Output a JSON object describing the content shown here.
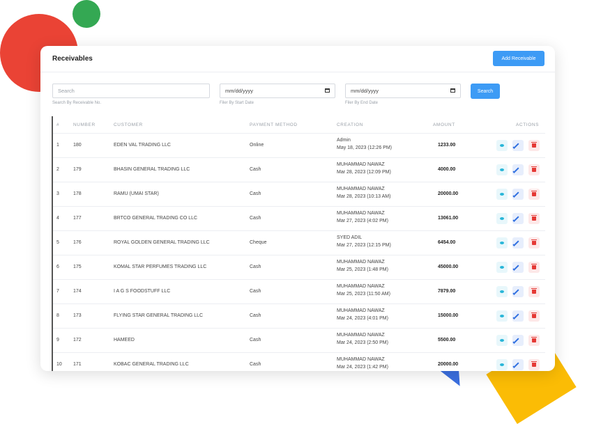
{
  "page": {
    "title": "Receivables",
    "add_button": "Add Receivable"
  },
  "filters": {
    "search_placeholder": "Search",
    "search_hint": "Search By Receivable No.",
    "start_date": "mm/dd/yyyy",
    "start_hint": "Filer By Start Date",
    "end_date": "mm/dd/yyyy",
    "end_hint": "Filer By End Date",
    "search_button": "Search"
  },
  "table": {
    "headers": {
      "index": "#",
      "number": "NUMBER",
      "customer": "CUSTOMER",
      "payment": "PAYMENT METHOD",
      "creation": "CREATION",
      "amount": "AMOUNT",
      "actions": "ACTIONS"
    },
    "rows": [
      {
        "index": "1",
        "number": "180",
        "customer": "EDEN VAL TRADING LLC",
        "payment": "Online",
        "created_by": "Admin",
        "created_at": "May 18, 2023 (12:26 PM)",
        "amount": "1233.00"
      },
      {
        "index": "2",
        "number": "179",
        "customer": "BHASIN GENERAL TRADING LLC",
        "payment": "Cash",
        "created_by": "MUHAMMAD NAWAZ",
        "created_at": "Mar 28, 2023 (12:09 PM)",
        "amount": "4000.00"
      },
      {
        "index": "3",
        "number": "178",
        "customer": "RAMU (UMAI STAR)",
        "payment": "Cash",
        "created_by": "MUHAMMAD NAWAZ",
        "created_at": "Mar 28, 2023 (10:13 AM)",
        "amount": "20000.00"
      },
      {
        "index": "4",
        "number": "177",
        "customer": "BRTCO GENERAL TRADING CO LLC",
        "payment": "Cash",
        "created_by": "MUHAMMAD NAWAZ",
        "created_at": "Mar 27, 2023 (4:02 PM)",
        "amount": "13061.00"
      },
      {
        "index": "5",
        "number": "176",
        "customer": "ROYAL GOLDEN GENERAL TRADING LLC",
        "payment": "Cheque",
        "created_by": "SYED ADIL",
        "created_at": "Mar 27, 2023 (12:15 PM)",
        "amount": "6454.00"
      },
      {
        "index": "6",
        "number": "175",
        "customer": "KOMAL STAR PERFUMES TRADING LLC",
        "payment": "Cash",
        "created_by": "MUHAMMAD NAWAZ",
        "created_at": "Mar 25, 2023 (1:48 PM)",
        "amount": "45000.00"
      },
      {
        "index": "7",
        "number": "174",
        "customer": "I A G S FOODSTUFF LLC",
        "payment": "Cash",
        "created_by": "MUHAMMAD NAWAZ",
        "created_at": "Mar 25, 2023 (11:50 AM)",
        "amount": "7879.00"
      },
      {
        "index": "8",
        "number": "173",
        "customer": "FLYING STAR GENERAL TRADING LLC",
        "payment": "Cash",
        "created_by": "MUHAMMAD NAWAZ",
        "created_at": "Mar 24, 2023 (4:01 PM)",
        "amount": "15000.00"
      },
      {
        "index": "9",
        "number": "172",
        "customer": "HAMEED",
        "payment": "Cash",
        "created_by": "MUHAMMAD NAWAZ",
        "created_at": "Mar 24, 2023 (2:50 PM)",
        "amount": "5500.00"
      },
      {
        "index": "10",
        "number": "171",
        "customer": "KOBAC GENERAL TRADING LLC",
        "payment": "Cash",
        "created_by": "MUHAMMAD NAWAZ",
        "created_at": "Mar 24, 2023 (1:42 PM)",
        "amount": "20000.00"
      }
    ]
  },
  "colors": {
    "primary": "#3d9bf5",
    "view": "#29b6d8",
    "edit": "#2f6fe0",
    "delete": "#e53935"
  },
  "icons": {
    "view": "eye-icon",
    "edit": "pencil-icon",
    "delete": "trash-icon",
    "date": "calendar-icon"
  }
}
